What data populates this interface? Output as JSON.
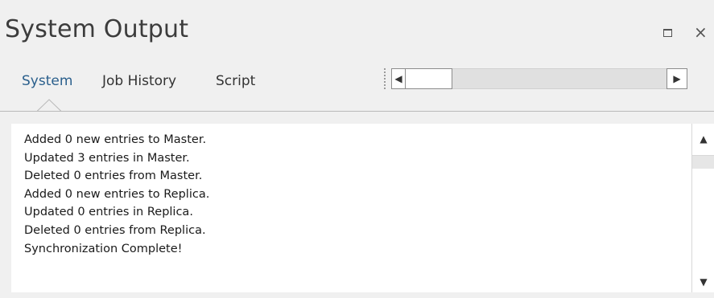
{
  "window": {
    "title": "System Output",
    "maximize_icon": "maximize-icon",
    "close_icon": "close-icon",
    "close_glyph": "×"
  },
  "tabs": [
    {
      "label": "System",
      "active": true
    },
    {
      "label": "Job History",
      "active": false
    },
    {
      "label": "Script",
      "active": false
    }
  ],
  "tab_scroller": {
    "left_glyph": "◀",
    "right_glyph": "▶"
  },
  "output": {
    "lines": [
      "Added 0 new entries to Master.",
      "Updated 3 entries in Master.",
      "Deleted 0 entries from Master.",
      "Added 0 new entries to Replica.",
      "Updated 0 entries in Replica.",
      "Deleted 0 entries from Replica.",
      "Synchronization Complete!"
    ]
  },
  "vertical_scrollbar": {
    "up_glyph": "▲",
    "down_glyph": "▼"
  },
  "colors": {
    "active_tab": "#2a5f8c",
    "background": "#f0f0f0",
    "output_background": "#ffffff"
  }
}
